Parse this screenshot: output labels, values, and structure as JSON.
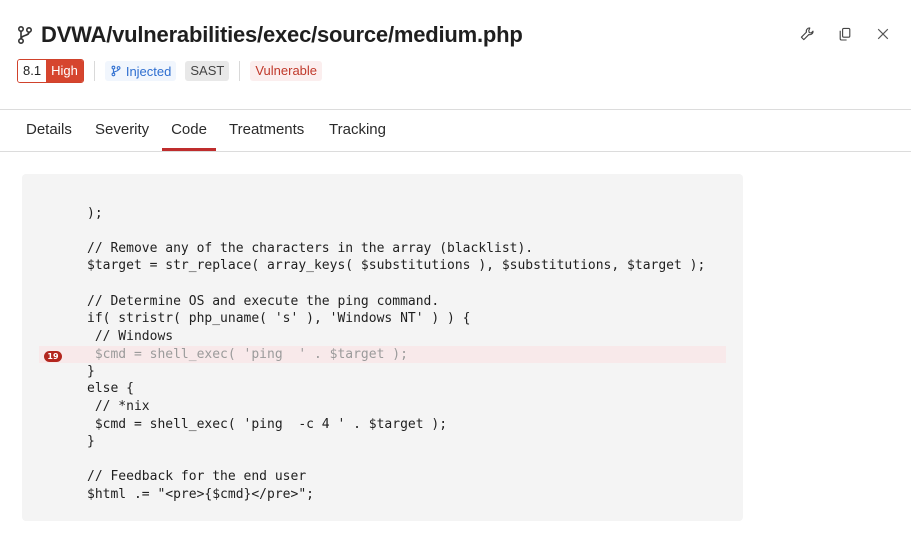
{
  "header": {
    "title": "DVWA/vulnerabilities/exec/source/medium.php",
    "score": "8.1",
    "severity": "High",
    "injected": "Injected",
    "type": "SAST",
    "status": "Vulnerable"
  },
  "tabs": [
    "Details",
    "Severity",
    "Code",
    "Treatments",
    "Tracking"
  ],
  "active_tab": "Code",
  "code": {
    "lines": [
      ");",
      "",
      "// Remove any of the characters in the array (blacklist).",
      "$target = str_replace( array_keys( $substitutions ), $substitutions, $target );",
      "",
      "// Determine OS and execute the ping command.",
      "if( stristr( php_uname( 's' ), 'Windows NT' ) ) {",
      " // Windows",
      " $cmd = shell_exec( 'ping  ' . $target );",
      "}",
      "else {",
      " // *nix",
      " $cmd = shell_exec( 'ping  -c 4 ' . $target );",
      "}",
      "",
      "// Feedback for the end user",
      "$html .= \"<pre>{$cmd}</pre>\";"
    ],
    "highlight_line_number": "19"
  },
  "colors": {
    "accent": "#bf2d2d",
    "severity": "#d6452e",
    "injected": "#2f6fd0"
  }
}
